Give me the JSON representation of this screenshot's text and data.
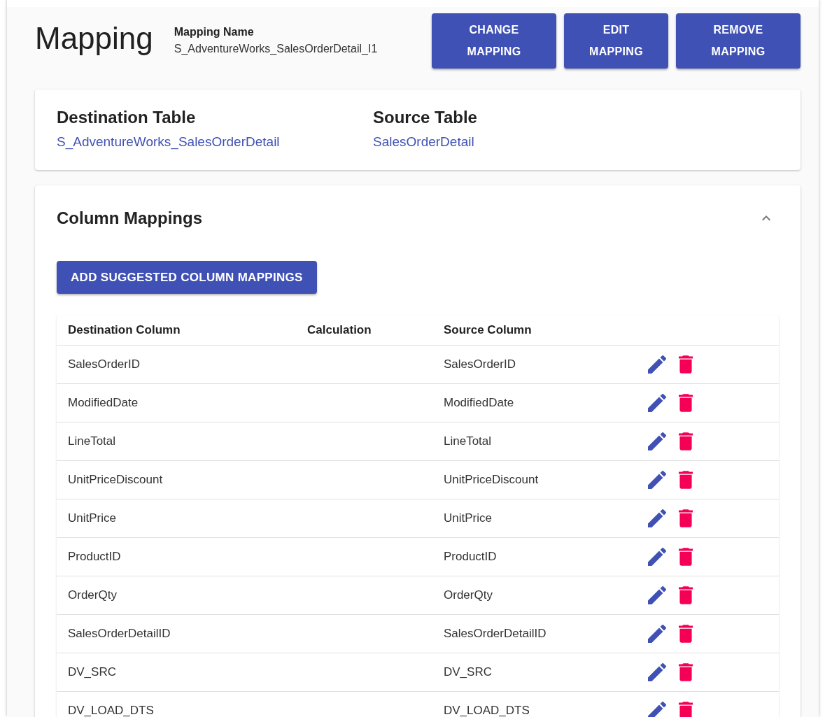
{
  "header": {
    "title": "Mapping",
    "name_label": "Mapping Name",
    "name_value": "S_AdventureWorks_SalesOrderDetail_I1",
    "buttons": [
      {
        "label": "CHANGE MAPPING"
      },
      {
        "label": "EDIT MAPPING"
      },
      {
        "label": "REMOVE MAPPING"
      }
    ]
  },
  "tables_card": {
    "destination": {
      "label": "Destination Table",
      "value": "S_AdventureWorks_SalesOrderDetail"
    },
    "source": {
      "label": "Source Table",
      "value": "SalesOrderDetail"
    }
  },
  "column_mappings": {
    "title": "Column Mappings",
    "expanded": true,
    "add_button": "ADD SUGGESTED COLUMN MAPPINGS",
    "columns": [
      "Destination Column",
      "Calculation",
      "Source Column"
    ],
    "rows": [
      {
        "destination": "SalesOrderID",
        "source": "SalesOrderID"
      },
      {
        "destination": "ModifiedDate",
        "source": "ModifiedDate"
      },
      {
        "destination": "LineTotal",
        "source": "LineTotal"
      },
      {
        "destination": "UnitPriceDiscount",
        "source": "UnitPriceDiscount"
      },
      {
        "destination": "UnitPrice",
        "source": "UnitPrice"
      },
      {
        "destination": "ProductID",
        "source": "ProductID"
      },
      {
        "destination": "OrderQty",
        "source": "OrderQty"
      },
      {
        "destination": "SalesOrderDetailID",
        "source": "SalesOrderDetailID"
      },
      {
        "destination": "DV_SRC",
        "source": "DV_SRC"
      },
      {
        "destination": "DV_LOAD_DTS",
        "source": "DV_LOAD_DTS"
      }
    ]
  }
}
